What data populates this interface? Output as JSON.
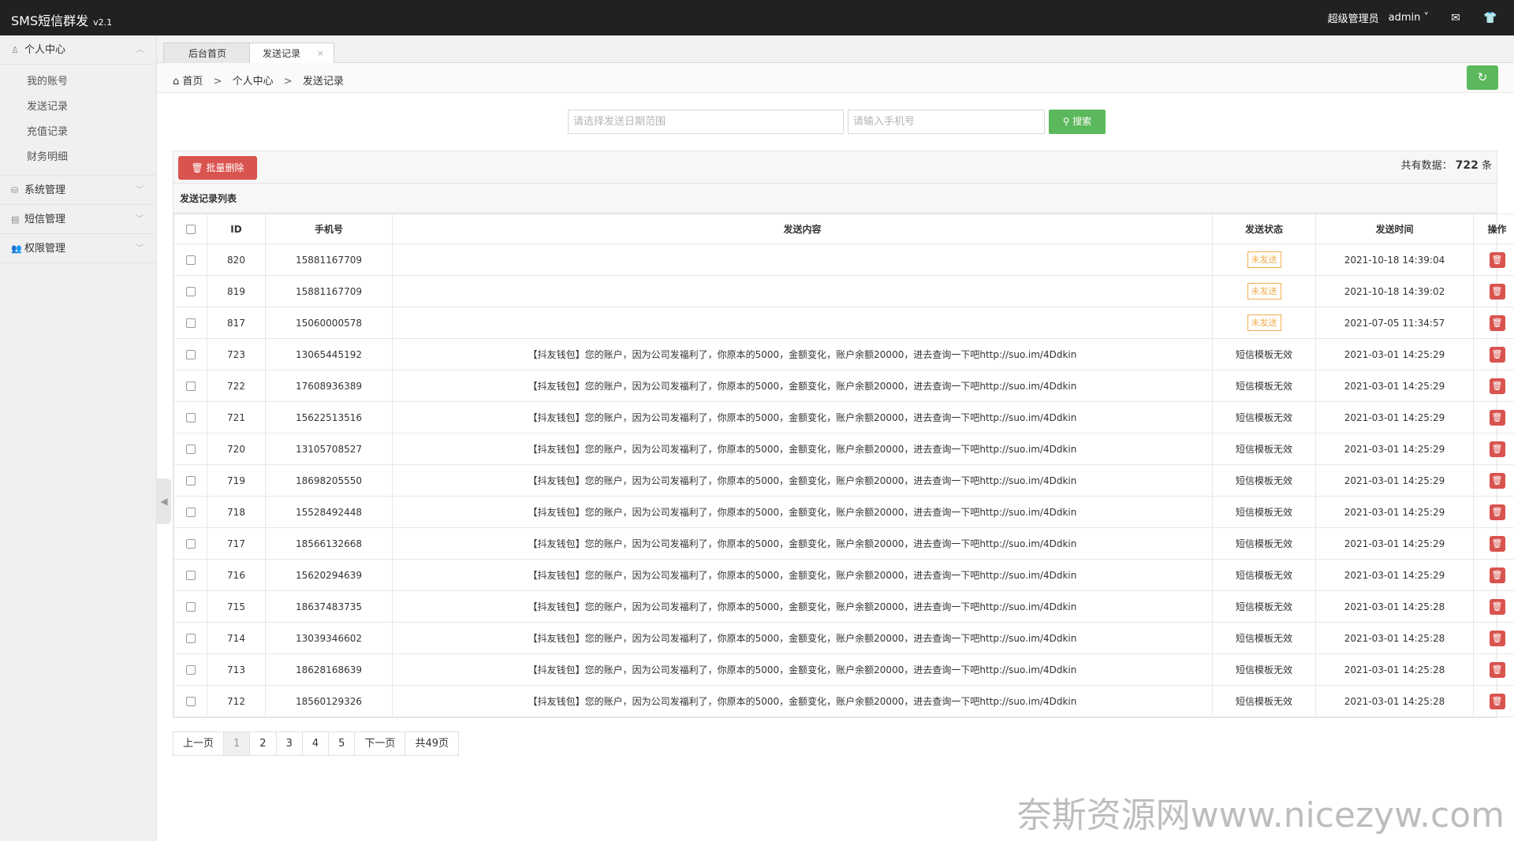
{
  "header": {
    "brand": "SMS短信群发",
    "version": "v2.1",
    "role": "超级管理员",
    "user": "admin",
    "icons": [
      "chevron-down-icon",
      "mail-icon",
      "shirt-icon"
    ]
  },
  "sidebar": {
    "personal": {
      "label": "个人中心",
      "items": [
        "我的账号",
        "发送记录",
        "充值记录",
        "财务明细"
      ]
    },
    "groups": [
      {
        "label": "系统管理"
      },
      {
        "label": "短信管理"
      },
      {
        "label": "权限管理"
      }
    ]
  },
  "tabs": [
    {
      "label": "后台首页"
    },
    {
      "label": "发送记录"
    }
  ],
  "breadcrumb": {
    "home": "首页",
    "sep": ">",
    "level2": "个人中心",
    "level3": "发送记录"
  },
  "search": {
    "date_placeholder": "请选择发送日期范围",
    "phone_placeholder": "请输入手机号",
    "button": "搜索"
  },
  "toolbar": {
    "batch_delete": "批量删除",
    "total_label": "共有数据：",
    "total_count": "722",
    "total_unit": "条"
  },
  "table": {
    "title": "发送记录列表",
    "headers": [
      "ID",
      "手机号",
      "发送内容",
      "发送状态",
      "发送时间",
      "操作"
    ],
    "rows": [
      {
        "id": "820",
        "phone": "15881167709",
        "content": "",
        "status": "未发送",
        "status_type": "unsent",
        "time": "2021-10-18 14:39:04"
      },
      {
        "id": "819",
        "phone": "15881167709",
        "content": "",
        "status": "未发送",
        "status_type": "unsent",
        "time": "2021-10-18 14:39:02"
      },
      {
        "id": "817",
        "phone": "15060000578",
        "content": "",
        "status": "未发送",
        "status_type": "unsent",
        "time": "2021-07-05 11:34:57"
      },
      {
        "id": "723",
        "phone": "13065445192",
        "content": "【抖友钱包】您的账户，因为公司发福利了，你原本的5000，金额变化，账户余额20000，进去查询一下吧http://suo.im/4Ddkin",
        "status": "短信模板无效",
        "status_type": "text",
        "time": "2021-03-01 14:25:29"
      },
      {
        "id": "722",
        "phone": "17608936389",
        "content": "【抖友钱包】您的账户，因为公司发福利了，你原本的5000，金额变化，账户余额20000，进去查询一下吧http://suo.im/4Ddkin",
        "status": "短信模板无效",
        "status_type": "text",
        "time": "2021-03-01 14:25:29"
      },
      {
        "id": "721",
        "phone": "15622513516",
        "content": "【抖友钱包】您的账户，因为公司发福利了，你原本的5000，金额变化，账户余额20000，进去查询一下吧http://suo.im/4Ddkin",
        "status": "短信模板无效",
        "status_type": "text",
        "time": "2021-03-01 14:25:29"
      },
      {
        "id": "720",
        "phone": "13105708527",
        "content": "【抖友钱包】您的账户，因为公司发福利了，你原本的5000，金额变化，账户余额20000，进去查询一下吧http://suo.im/4Ddkin",
        "status": "短信模板无效",
        "status_type": "text",
        "time": "2021-03-01 14:25:29"
      },
      {
        "id": "719",
        "phone": "18698205550",
        "content": "【抖友钱包】您的账户，因为公司发福利了，你原本的5000，金额变化，账户余额20000，进去查询一下吧http://suo.im/4Ddkin",
        "status": "短信模板无效",
        "status_type": "text",
        "time": "2021-03-01 14:25:29"
      },
      {
        "id": "718",
        "phone": "15528492448",
        "content": "【抖友钱包】您的账户，因为公司发福利了，你原本的5000，金额变化，账户余额20000，进去查询一下吧http://suo.im/4Ddkin",
        "status": "短信模板无效",
        "status_type": "text",
        "time": "2021-03-01 14:25:29"
      },
      {
        "id": "717",
        "phone": "18566132668",
        "content": "【抖友钱包】您的账户，因为公司发福利了，你原本的5000，金额变化，账户余额20000，进去查询一下吧http://suo.im/4Ddkin",
        "status": "短信模板无效",
        "status_type": "text",
        "time": "2021-03-01 14:25:29"
      },
      {
        "id": "716",
        "phone": "15620294639",
        "content": "【抖友钱包】您的账户，因为公司发福利了，你原本的5000，金额变化，账户余额20000，进去查询一下吧http://suo.im/4Ddkin",
        "status": "短信模板无效",
        "status_type": "text",
        "time": "2021-03-01 14:25:29"
      },
      {
        "id": "715",
        "phone": "18637483735",
        "content": "【抖友钱包】您的账户，因为公司发福利了，你原本的5000，金额变化，账户余额20000，进去查询一下吧http://suo.im/4Ddkin",
        "status": "短信模板无效",
        "status_type": "text",
        "time": "2021-03-01 14:25:28"
      },
      {
        "id": "714",
        "phone": "13039346602",
        "content": "【抖友钱包】您的账户，因为公司发福利了，你原本的5000，金额变化，账户余额20000，进去查询一下吧http://suo.im/4Ddkin",
        "status": "短信模板无效",
        "status_type": "text",
        "time": "2021-03-01 14:25:28"
      },
      {
        "id": "713",
        "phone": "18628168639",
        "content": "【抖友钱包】您的账户，因为公司发福利了，你原本的5000，金额变化，账户余额20000，进去查询一下吧http://suo.im/4Ddkin",
        "status": "短信模板无效",
        "status_type": "text",
        "time": "2021-03-01 14:25:28"
      },
      {
        "id": "712",
        "phone": "18560129326",
        "content": "【抖友钱包】您的账户，因为公司发福利了，你原本的5000，金额变化，账户余额20000，进去查询一下吧http://suo.im/4Ddkin",
        "status": "短信模板无效",
        "status_type": "text",
        "time": "2021-03-01 14:25:28"
      }
    ]
  },
  "pagination": {
    "prev": "上一页",
    "pages": [
      "1",
      "2",
      "3",
      "4",
      "5"
    ],
    "current": "1",
    "next": "下一页",
    "total": "共49页"
  },
  "watermark": "奈斯资源网www.nicezyw.com",
  "colors": {
    "topbar": "#212121",
    "green": "#5cb85c",
    "red": "#d9534f",
    "orange": "#f0ad4e"
  }
}
